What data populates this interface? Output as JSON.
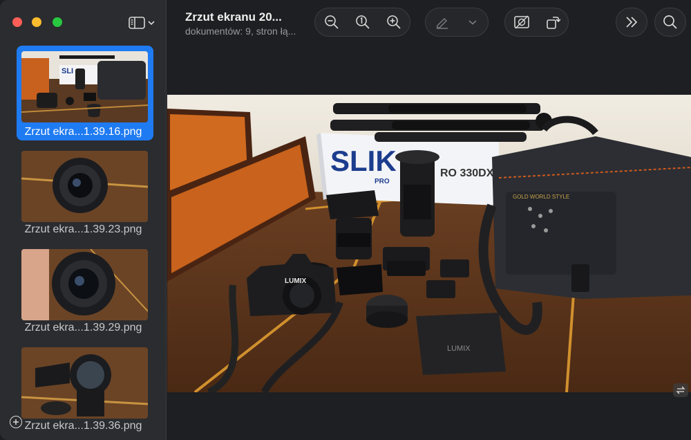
{
  "window": {
    "title": "Zrzut ekranu 20...",
    "subtitle": "dokumentów: 9, stron łą..."
  },
  "sidebar": {
    "thumbnails": [
      {
        "label": "Zrzut ekra...1.39.16.png",
        "selected": true
      },
      {
        "label": "Zrzut ekra...1.39.23.png",
        "selected": false
      },
      {
        "label": "Zrzut ekra...1.39.29.png",
        "selected": false
      },
      {
        "label": "Zrzut ekra...1.39.36.png",
        "selected": false
      }
    ]
  },
  "toolbar": {
    "icons": [
      "sidebar-toggle-icon",
      "zoom-out-icon",
      "actual-size-icon",
      "zoom-in-icon",
      "markup-pen-icon",
      "chevron-down-icon",
      "crop-icon",
      "rotate-icon",
      "more-chevrons-icon",
      "search-icon"
    ]
  },
  "photo": {
    "box_text": "SLIK",
    "box_model": "RO 330DX",
    "box_small": "PRO",
    "camera_brand": "LUMIX",
    "pouch_brand": "LUMIX",
    "bag_brand": "GOLD WORLD STYLE"
  },
  "colors": {
    "accent": "#1f7bf2",
    "close": "#ff5f57",
    "minimize": "#febc2e",
    "maximize": "#28c840"
  }
}
